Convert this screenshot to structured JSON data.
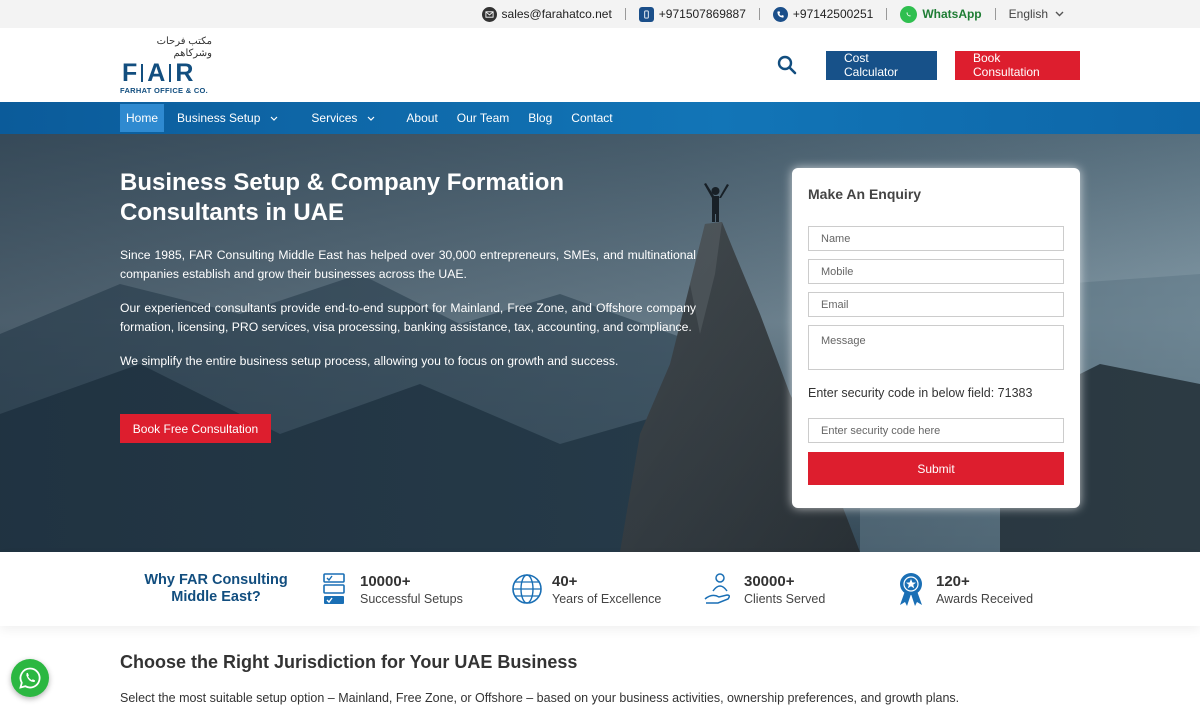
{
  "topbar": {
    "email": "sales@farahatco.net",
    "phone1": "+971507869887",
    "phone2": "+97142500251",
    "whatsapp": "WhatsApp",
    "language": "English",
    "icons": [
      "mail-icon",
      "mobile-icon",
      "phone-icon",
      "whatsapp-icon",
      "chevron-down-icon"
    ]
  },
  "logo": {
    "arabic": "مكتب فرحات وشركاهم",
    "letters": [
      "F",
      "A",
      "R"
    ],
    "subtitle": "FARHAT OFFICE & CO."
  },
  "header": {
    "cost_calculator": "Cost Calculator",
    "book_consultation": "Book Consultation"
  },
  "nav": {
    "items": [
      {
        "label": "Home",
        "active": true
      },
      {
        "label": "Business Setup",
        "dropdown": true
      },
      {
        "label": "Services",
        "dropdown": true
      },
      {
        "label": "About"
      },
      {
        "label": "Our Team"
      },
      {
        "label": "Blog"
      },
      {
        "label": "Contact"
      }
    ]
  },
  "hero": {
    "title": "Business Setup & Company Formation Consultants in UAE",
    "p1": "Since 1985, FAR Consulting Middle East has helped over 30,000 entrepreneurs, SMEs, and multinational companies establish and grow their businesses across the UAE.",
    "p2": "Our experienced consultants provide end-to-end support for Mainland, Free Zone, and Offshore company formation, licensing, PRO services, visa processing, banking assistance, tax, accounting, and compliance.",
    "p3": "We simplify the entire business setup process, allowing you to focus on growth and success.",
    "cta": "Book Free Consultation"
  },
  "enquiry": {
    "title": "Make An Enquiry",
    "name_placeholder": "Name",
    "mobile_placeholder": "Mobile",
    "email_placeholder": "Email",
    "message_placeholder": "Message",
    "security_label": "Enter security code in below field: 71383",
    "security_placeholder": "Enter security code here",
    "submit": "Submit"
  },
  "stats": {
    "why": "Why FAR Consulting Middle East?",
    "items": [
      {
        "num": "10000+",
        "label": "Successful Setups",
        "icon": "checklist-icon"
      },
      {
        "num": "40+",
        "label": "Years of Excellence",
        "icon": "globe-icon"
      },
      {
        "num": "30000+",
        "label": "Clients Served",
        "icon": "hand-person-icon"
      },
      {
        "num": "120+",
        "label": "Awards Received",
        "icon": "award-ribbon-icon"
      }
    ]
  },
  "jurisdiction": {
    "title": "Choose the Right Jurisdiction for Your UAE Business",
    "text": "Select the most suitable setup option – Mainland, Free Zone, or Offshore – based on your business activities, ownership preferences, and growth plans."
  },
  "colors": {
    "brand_blue": "#124e7f",
    "accent_red": "#dd1e2e",
    "nav_blue": "#0b5b9a",
    "whatsapp_green": "#2bb741"
  }
}
